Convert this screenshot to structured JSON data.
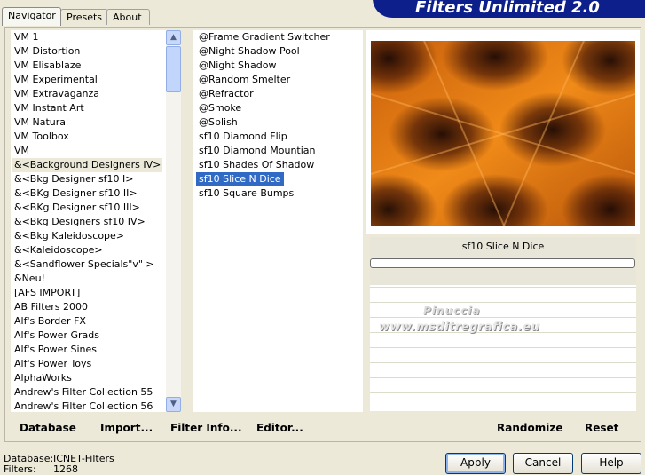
{
  "tabs": [
    "Navigator",
    "Presets",
    "About"
  ],
  "title": "Filters Unlimited 2.0",
  "categories": [
    "VM 1",
    "VM Distortion",
    "VM Elisablaze",
    "VM Experimental",
    "VM Extravaganza",
    "VM Instant Art",
    "VM Natural",
    "VM Toolbox",
    "VM",
    "&<Background Designers IV>",
    "&<Bkg Designer sf10 I>",
    "&<BKg Designer sf10 II>",
    "&<BKg Designer sf10 III>",
    "&<Bkg Designers sf10 IV>",
    "&<Bkg Kaleidoscope>",
    "&<Kaleidoscope>",
    "&<Sandflower Specials\"v\" >",
    "&Neu!",
    "[AFS IMPORT]",
    "AB Filters 2000",
    "Alf's Border FX",
    "Alf's Power Grads",
    "Alf's Power Sines",
    "Alf's Power Toys",
    "AlphaWorks",
    "Andrew's Filter Collection 55",
    "Andrew's Filter Collection 56"
  ],
  "filters": [
    "@Frame Gradient Switcher",
    "@Night Shadow Pool",
    "@Night Shadow",
    "@Random Smelter",
    "@Refractor",
    "@Smoke",
    "@Splish",
    "sf10 Diamond Flip",
    "sf10 Diamond Mountian",
    "sf10 Shades Of Shadow",
    "sf10 Slice N Dice",
    "sf10 Square Bumps"
  ],
  "selected_filter": "sf10 Slice N Dice",
  "filter_name": "sf10 Slice N Dice",
  "watermark": {
    "line1": "Pinuccia",
    "line2": "www.msditregrafica.eu"
  },
  "toolbar": {
    "database": "Database",
    "import": "Import...",
    "filter_info": "Filter Info...",
    "editor": "Editor...",
    "randomize": "Randomize",
    "reset": "Reset"
  },
  "status": {
    "database_label": "Database:",
    "database_value": "ICNET-Filters",
    "filters_label": "Filters:",
    "filters_value": "1268"
  },
  "dialog": {
    "apply": "Apply",
    "cancel": "Cancel",
    "help": "Help"
  },
  "colors": {
    "selection": "#316ac5",
    "banner": "#0c1f8a",
    "preview_orange": "#e07a10",
    "preview_dark": "#2a0f08"
  }
}
